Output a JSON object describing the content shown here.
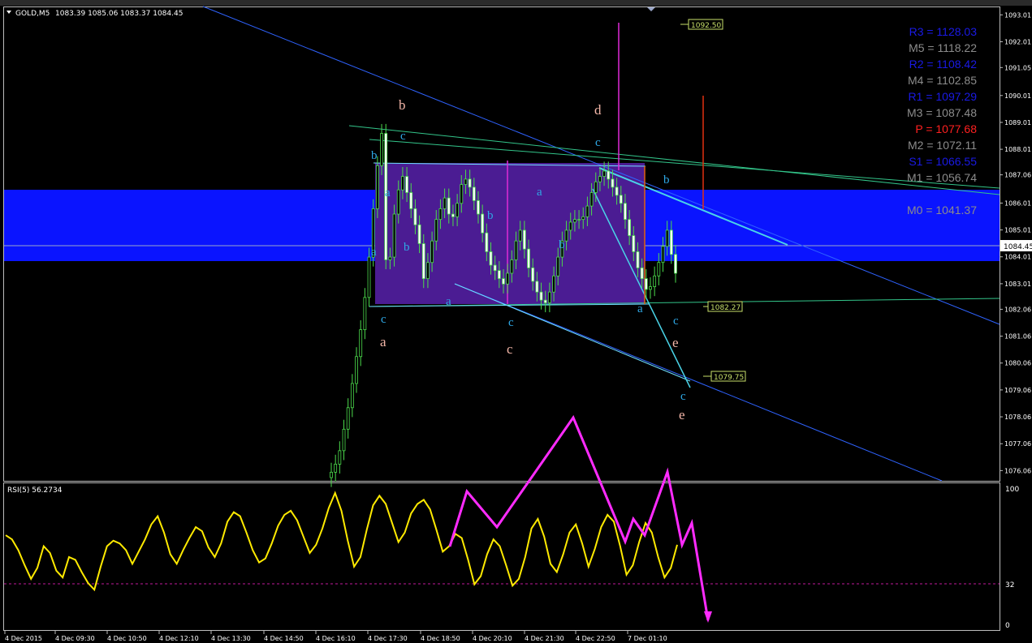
{
  "window": {
    "symbol_title": "GOLD,M5",
    "ohlc": "1083.39 1085.06 1083.37 1084.45"
  },
  "chart_data": [
    {
      "type": "candlestick",
      "title": "GOLD,M5",
      "ohlc_label": "1083.39 1085.06 1083.37 1084.45",
      "ylim": [
        1075.8,
        1093.2
      ],
      "yticks": [
        "1093.01",
        "1092.01",
        "1091.05",
        "1090.01",
        "1089.01",
        "1088.01",
        "1087.06",
        "1086.01",
        "1085.01",
        "1084.01",
        "1083.01",
        "1082.06",
        "1081.06",
        "1080.06",
        "1079.06",
        "1078.06",
        "1077.06",
        "1076.06"
      ],
      "current_price": "1084.45",
      "price_labels": [
        "1092.50",
        "1082.27",
        "1079.75"
      ],
      "pivot_levels": [
        {
          "label": "R3 = 1128.03",
          "color": "#1a1ae6"
        },
        {
          "label": "M5 = 1118.22",
          "color": "#8c8c8c"
        },
        {
          "label": "R2 = 1108.42",
          "color": "#1a1ae6"
        },
        {
          "label": "M4 = 1102.85",
          "color": "#8c8c8c"
        },
        {
          "label": "R1 = 1097.29",
          "color": "#1a1ae6"
        },
        {
          "label": "M3 = 1087.48",
          "color": "#8c8c8c"
        },
        {
          "label": "P  = 1077.68",
          "color": "#ff2020"
        },
        {
          "label": "M2 = 1072.11",
          "color": "#8c8c8c"
        },
        {
          "label": "S1 = 1066.55",
          "color": "#1a1ae6"
        },
        {
          "label": "M1 = 1056.74",
          "color": "#8c8c8c"
        },
        {
          "label": "M0 = 1041.37",
          "color": "#8c8c8c"
        }
      ],
      "wave_labels_blue": [
        "c",
        "b",
        "a",
        "a",
        "b",
        "b",
        "a",
        "a",
        "b",
        "c",
        "a",
        "b",
        "c",
        "c",
        "c",
        "c"
      ],
      "wave_labels_pink": [
        "b",
        "d",
        "a",
        "c",
        "e",
        "e"
      ],
      "close_prices": [
        1083.9,
        1084.0,
        1085.6,
        1086.5,
        1087.0,
        1086.4,
        1085.8,
        1085.2,
        1084.5,
        1083.2,
        1083.8,
        1084.6,
        1085.4,
        1085.8,
        1086.2,
        1085.6,
        1085.5,
        1086.0,
        1086.7,
        1086.9,
        1086.6,
        1086.1,
        1085.6,
        1084.9,
        1084.2,
        1083.7,
        1083.5,
        1083.2,
        1083.0,
        1083.4,
        1083.9,
        1084.6,
        1085.0,
        1084.3,
        1083.6,
        1083.1,
        1082.7,
        1082.4,
        1082.3,
        1082.7,
        1083.3,
        1084.0,
        1084.6,
        1085.0,
        1085.3,
        1085.4,
        1085.4,
        1085.5,
        1085.9,
        1086.4,
        1086.8,
        1087.0,
        1087.2,
        1086.9,
        1086.6,
        1086.3,
        1086.0,
        1085.4,
        1084.8,
        1084.2,
        1083.6,
        1083.2,
        1082.8,
        1082.9,
        1083.3,
        1083.8,
        1084.4,
        1085.0,
        1084.1,
        1083.4
      ]
    },
    {
      "type": "line",
      "title": "RSI(5) 56.2734",
      "ylim": [
        0,
        100
      ],
      "yticks": [
        "100",
        "32",
        "0"
      ],
      "level": 32,
      "x_ticks": [
        "4 Dec 2015",
        "4 Dec 09:30",
        "4 Dec 10:50",
        "4 Dec 12:10",
        "4 Dec 13:30",
        "4 Dec 14:50",
        "4 Dec 16:10",
        "4 Dec 17:30",
        "4 Dec 18:50",
        "4 Dec 20:10",
        "4 Dec 21:30",
        "4 Dec 22:50",
        "7 Dec 01:10"
      ],
      "values": [
        66,
        63,
        55,
        44,
        34,
        42,
        58,
        53,
        40,
        35,
        50,
        48,
        39,
        31,
        26,
        43,
        58,
        62,
        60,
        55,
        45,
        54,
        63,
        74,
        80,
        68,
        52,
        45,
        55,
        64,
        72,
        69,
        57,
        50,
        60,
        76,
        83,
        80,
        68,
        55,
        46,
        49,
        60,
        73,
        81,
        84,
        77,
        65,
        53,
        59,
        71,
        86,
        97,
        84,
        62,
        43,
        50,
        70,
        88,
        95,
        89,
        75,
        61,
        68,
        82,
        89,
        92,
        85,
        70,
        54,
        58,
        67,
        64,
        48,
        30,
        36,
        52,
        63,
        58,
        44,
        29,
        34,
        50,
        71,
        78,
        65,
        45,
        39,
        52,
        68,
        74,
        60,
        43,
        56,
        72,
        81,
        76,
        58,
        37,
        44,
        61,
        75,
        68,
        50,
        35,
        42,
        59
      ]
    }
  ]
}
